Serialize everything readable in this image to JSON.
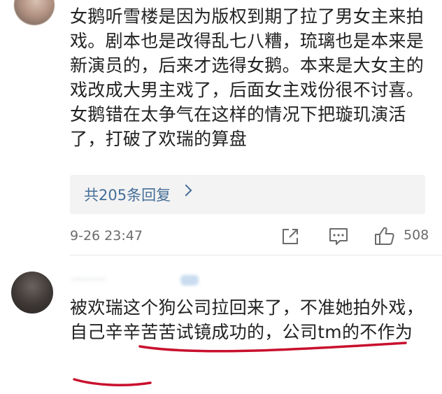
{
  "comment1": {
    "text": "女鹅听雪楼是因为版权到期了拉了男女主来拍戏。剧本也是改得乱七八糟，琉璃也是本来是新演员的，后来才选得女鹅。本来是大女主的戏改成大男主戏了，后面女主戏份很不讨喜。女鹅错在太争气在这样的情况下把璇玑演活了，打破了欢瑞的算盘",
    "replies_label": "共205条回复",
    "timestamp": "9-26 23:47",
    "like_count": "508",
    "icons": [
      "share-icon",
      "comment-icon",
      "like-icon",
      "chevron-right-icon"
    ]
  },
  "comment2": {
    "username": "·········",
    "text": "被欢瑞这个狗公司拉回来了，不准她拍外戏，自己辛辛苦苦试镜成功的，公司tm的不作为"
  },
  "colors": {
    "text": "#222222",
    "link": "#456e98",
    "meta": "#6b6b6b",
    "reply_bg": "#f3f3f3",
    "annotation_underline": "#c8102e"
  }
}
